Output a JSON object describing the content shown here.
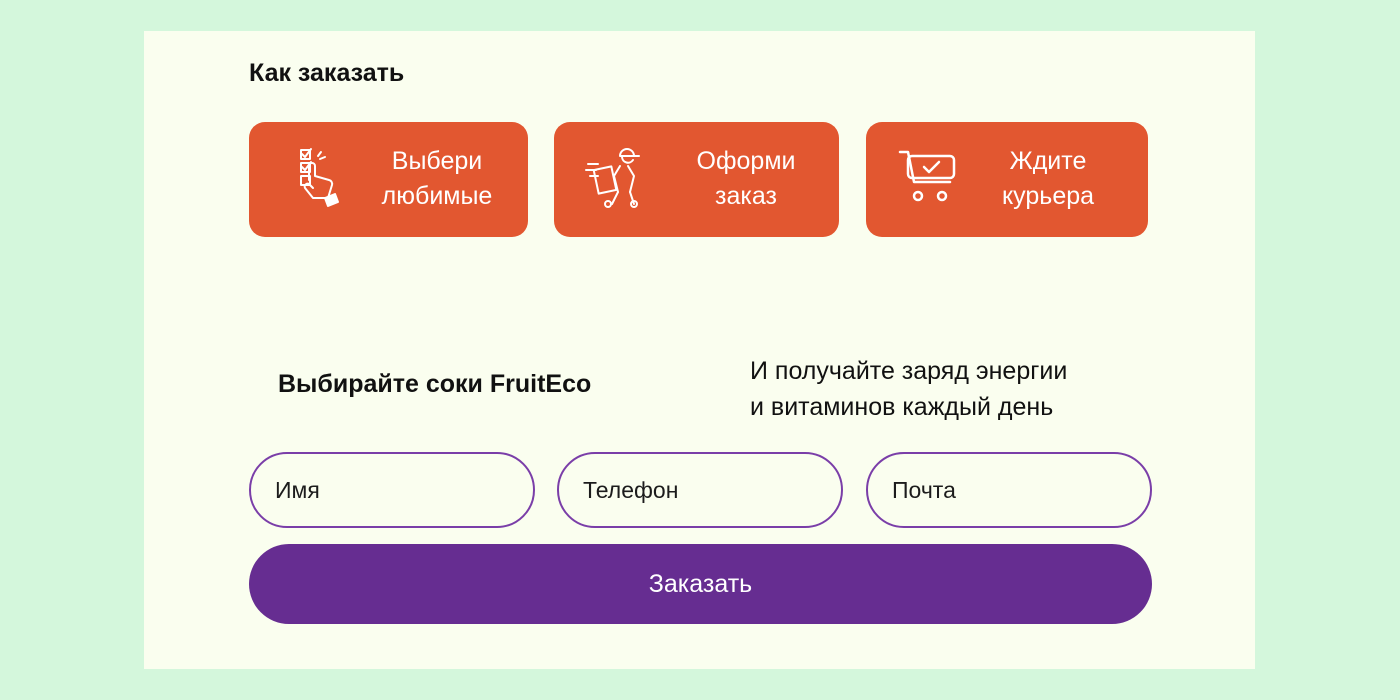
{
  "colors": {
    "page_background": "#d4f7dc",
    "card_background": "#fafeef",
    "step_accent": "#e25730",
    "button_purple": "#662d91",
    "field_border": "#7a3ea8"
  },
  "how_to_order": {
    "title": "Как заказать",
    "steps": [
      {
        "icon": "checklist-hand-icon",
        "line1": "Выбери",
        "line2": "любимые"
      },
      {
        "icon": "courier-icon",
        "line1": "Оформи",
        "line2": "заказ"
      },
      {
        "icon": "shopping-cart-icon",
        "line1": "Ждите",
        "line2": "курьера"
      }
    ]
  },
  "promo": {
    "title": "Выбирайте соки FruitEco",
    "text_line1": "И получайте заряд энергии",
    "text_line2": "и витаминов каждый день"
  },
  "form": {
    "name_placeholder": "Имя",
    "phone_placeholder": "Телефон",
    "email_placeholder": "Почта",
    "submit_label": "Заказать"
  }
}
